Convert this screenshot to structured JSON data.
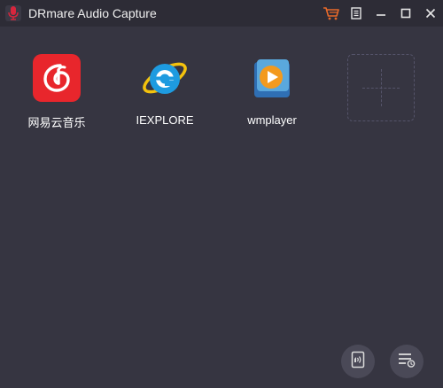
{
  "window": {
    "title": "DRmare Audio Capture",
    "accent_color": "#e8692a"
  },
  "titlebar_icons": {
    "cart": "shopping-cart-icon",
    "menu": "menu-icon",
    "minimize": "minimize-icon",
    "maximize": "maximize-icon",
    "close": "close-icon"
  },
  "apps": [
    {
      "label": "网易云音乐",
      "icon": "netease-cloud-music-icon",
      "color": "#e8262c"
    },
    {
      "label": "IEXPLORE",
      "icon": "internet-explorer-icon",
      "color": "#1e9be0"
    },
    {
      "label": "wmplayer",
      "icon": "windows-media-player-icon",
      "color": "#f39a1e"
    }
  ],
  "add_tile": {
    "icon": "add-icon"
  },
  "bottom_buttons": [
    {
      "icon": "audio-files-icon"
    },
    {
      "icon": "history-list-icon"
    }
  ]
}
